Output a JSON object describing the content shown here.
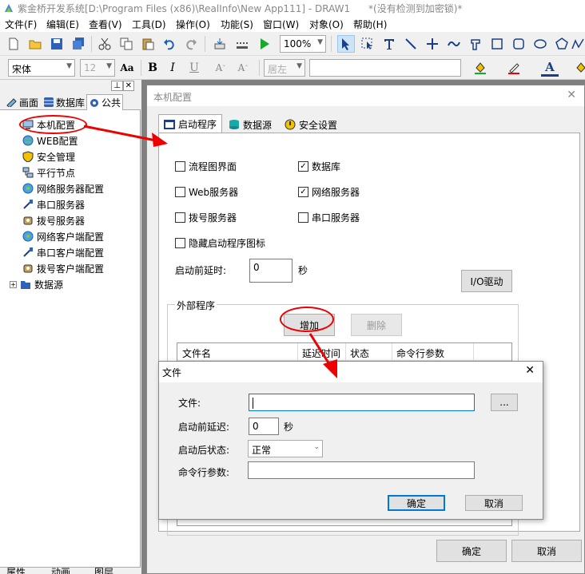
{
  "app": {
    "title": "紫金桥开发系统[D:\\Program Files (x86)\\RealInfo\\New App111] - DRAW1",
    "license": "*(没有检测到加密锁)*"
  },
  "menu": [
    "文件(F)",
    "编辑(E)",
    "查看(V)",
    "工具(D)",
    "操作(O)",
    "功能(S)",
    "窗口(W)",
    "对象(O)",
    "帮助(H)"
  ],
  "toolbar1": {
    "zoom": "100%",
    "icons": [
      "new-icon",
      "open-icon",
      "save-icon",
      "save-all-icon",
      "cut-icon",
      "copy-icon",
      "paste-icon",
      "undo-icon",
      "redo-icon",
      "compile-icon",
      "grid-icon",
      "run-icon"
    ]
  },
  "toolbar2": {
    "font": "宋体",
    "size": "12",
    "font_preview": "Aa",
    "align": "居左",
    "bold": "B",
    "italic": "I",
    "underline": "U"
  },
  "left_panel": {
    "tabs": [
      "画面",
      "数据库",
      "公共"
    ],
    "tree": [
      "本机配置",
      "WEB配置",
      "安全管理",
      "平行节点",
      "网络服务器配置",
      "串口服务器",
      "拨号服务器",
      "网络客户端配置",
      "串口客户端配置",
      "拨号客户端配置",
      "数据源"
    ],
    "bottom_tabs": [
      "属性",
      "动画",
      "图层"
    ]
  },
  "config_window": {
    "title": "本机配置",
    "tabs": [
      "启动程序",
      "数据源",
      "安全设置"
    ],
    "checks": [
      {
        "label": "流程图界面",
        "checked": false
      },
      {
        "label": "数据库",
        "checked": true
      },
      {
        "label": "Web服务器",
        "checked": false
      },
      {
        "label": "网络服务器",
        "checked": true
      },
      {
        "label": "拨号服务器",
        "checked": false
      },
      {
        "label": "串口服务器",
        "checked": false
      },
      {
        "label": "隐藏启动程序图标",
        "checked": false
      }
    ],
    "delay_label": "启动前延时:",
    "delay_value": "0",
    "delay_unit": "秒",
    "io_button": "I/O驱动",
    "external_group": "外部程序",
    "add_button": "增加",
    "delete_button": "删除",
    "columns": [
      "文件名",
      "延迟时间",
      "状态",
      "命令行参数"
    ],
    "ok_button": "确定",
    "cancel_button": "取消"
  },
  "file_dialog": {
    "title": "文件",
    "file_label": "文件:",
    "file_value": "",
    "browse_label": "...",
    "pre_delay_label": "启动前延迟:",
    "pre_delay_value": "0",
    "pre_delay_unit": "秒",
    "post_state_label": "启动后状态:",
    "post_state_value": "正常",
    "args_label": "命令行参数:",
    "args_value": "",
    "ok_button": "确定",
    "cancel_button": "取消"
  },
  "colors": {
    "annotation": "#e00000",
    "accent": "#0078d7"
  }
}
